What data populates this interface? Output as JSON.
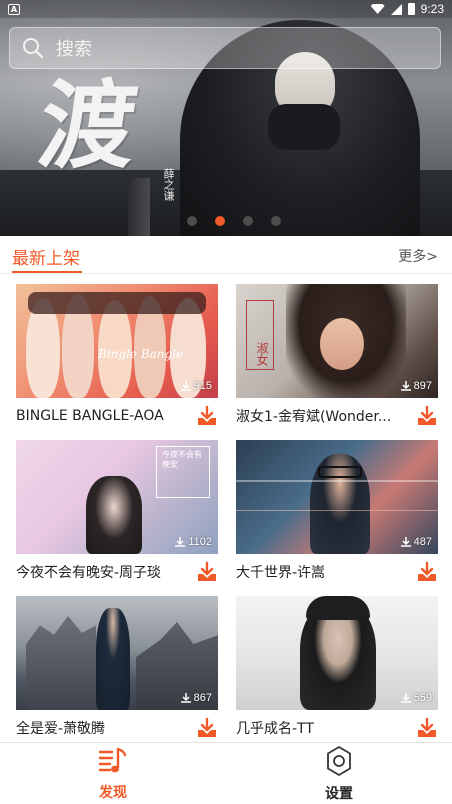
{
  "status_bar": {
    "time": "9:23",
    "left_badge": "A"
  },
  "search": {
    "placeholder": "搜索"
  },
  "banner": {
    "calligraphy": "渡",
    "signature": "薛之谦",
    "slide_count": 4,
    "active_slide": 1
  },
  "section": {
    "title": "最新上架",
    "more_label": "更多>"
  },
  "songs": [
    {
      "title": "BINGLE BANGLE-AOA",
      "downloads": "915",
      "cover_text": "Bingle Bangle"
    },
    {
      "title": "淑女1-金宥斌(Wonder...",
      "downloads": "897",
      "cover_text": "淑女"
    },
    {
      "title": "今夜不会有晚安-周子琰",
      "downloads": "1102",
      "cover_text": "今夜不会有晚安"
    },
    {
      "title": "大千世界-许嵩",
      "downloads": "487"
    },
    {
      "title": "全是爱-萧敬腾",
      "downloads": "867"
    },
    {
      "title": "几乎成名-TT",
      "downloads": "559"
    }
  ],
  "nav": {
    "discover": "发现",
    "settings": "设置"
  },
  "colors": {
    "accent": "#ef5a28"
  }
}
